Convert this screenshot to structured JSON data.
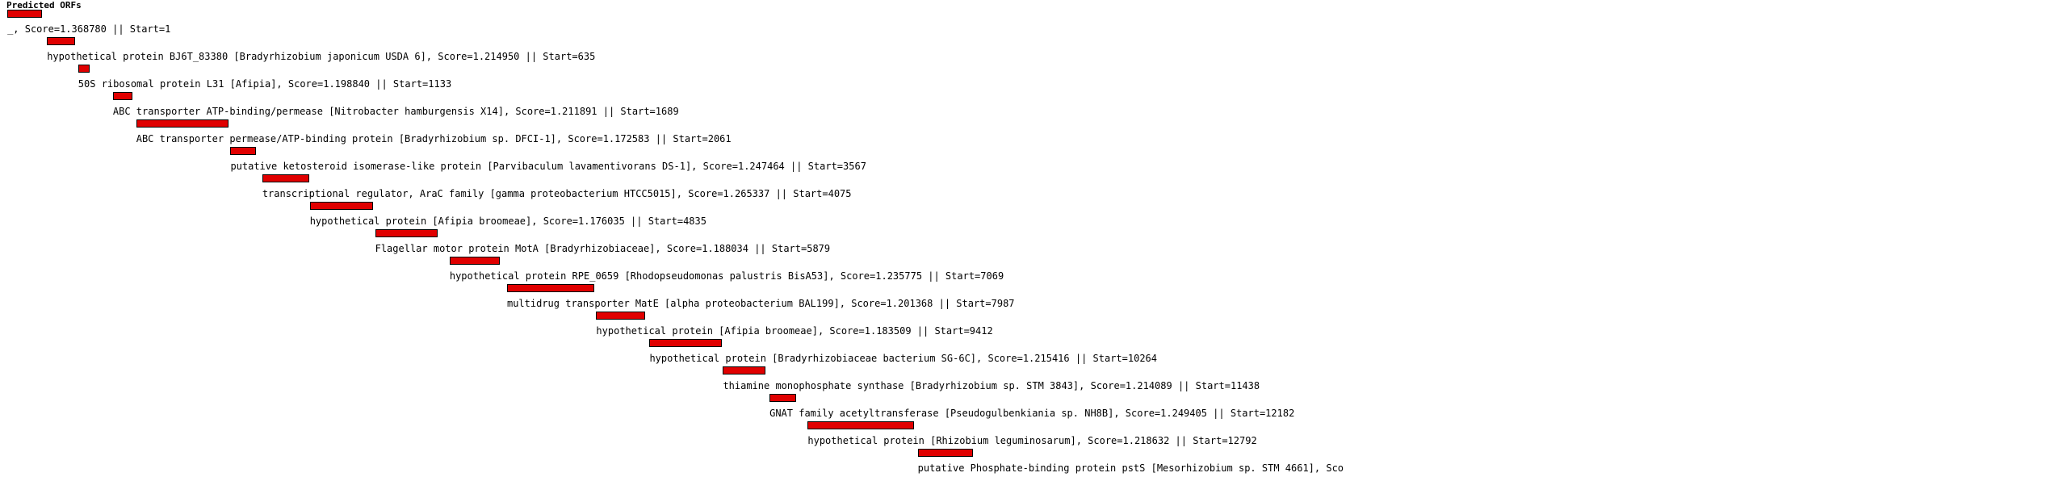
{
  "title": "Predicted ORFs",
  "bar_color": "#e00000",
  "scale_max": 14500,
  "orfs": [
    {
      "label": "_, Score=1.368780 || Start=1",
      "start": 1,
      "end": 560
    },
    {
      "label": "hypothetical protein BJ6T_83380 [Bradyrhizobium japonicum USDA 6], Score=1.214950 || Start=635",
      "start": 635,
      "end": 1085
    },
    {
      "label": "50S ribosomal protein L31 [Afipia], Score=1.198840 || Start=1133",
      "start": 1133,
      "end": 1320
    },
    {
      "label": "ABC transporter ATP-binding/permease [Nitrobacter hamburgensis X14], Score=1.211891 || Start=1689",
      "start": 1689,
      "end": 2000
    },
    {
      "label": "ABC transporter permease/ATP-binding protein [Bradyrhizobium sp. DFCI-1], Score=1.172583 || Start=2061",
      "start": 2061,
      "end": 3530
    },
    {
      "label": "putative ketosteroid isomerase-like protein [Parvibaculum lavamentivorans DS-1], Score=1.247464 || Start=3567",
      "start": 3567,
      "end": 3980
    },
    {
      "label": "transcriptional regulator, AraC family [gamma proteobacterium HTCC5015], Score=1.265337 || Start=4075",
      "start": 4075,
      "end": 4820
    },
    {
      "label": "hypothetical protein [Afipia broomeae], Score=1.176035 || Start=4835",
      "start": 4835,
      "end": 5850
    },
    {
      "label": "Flagellar motor protein MotA [Bradyrhizobiaceae], Score=1.188034 || Start=5879",
      "start": 5879,
      "end": 6880
    },
    {
      "label": "hypothetical protein RPE_0659 [Rhodopseudomonas palustris BisA53], Score=1.235775 || Start=7069",
      "start": 7069,
      "end": 7870
    },
    {
      "label": "multidrug transporter MatE [alpha proteobacterium BAL199], Score=1.201368 || Start=7987",
      "start": 7987,
      "end": 9380
    },
    {
      "label": "hypothetical protein [Afipia broomeae], Score=1.183509 || Start=9412",
      "start": 9412,
      "end": 10190
    },
    {
      "label": "hypothetical protein [Bradyrhizobiaceae bacterium SG-6C], Score=1.215416 || Start=10264",
      "start": 10264,
      "end": 11420
    },
    {
      "label": "thiamine monophosphate synthase [Bradyrhizobium sp. STM 3843], Score=1.214089 || Start=11438",
      "start": 11438,
      "end": 12110
    },
    {
      "label": "GNAT family acetyltransferase [Pseudogulbenkiania sp. NH8B], Score=1.249405 || Start=12182",
      "start": 12182,
      "end": 12610
    },
    {
      "label": "hypothetical protein [Rhizobium leguminosarum], Score=1.218632 || Start=12792",
      "start": 12792,
      "end": 14490
    },
    {
      "label": "putative Phosphate-binding protein pstS [Mesorhizobium sp. STM 4661], Sco",
      "start": 14550,
      "end": 15430
    }
  ]
}
